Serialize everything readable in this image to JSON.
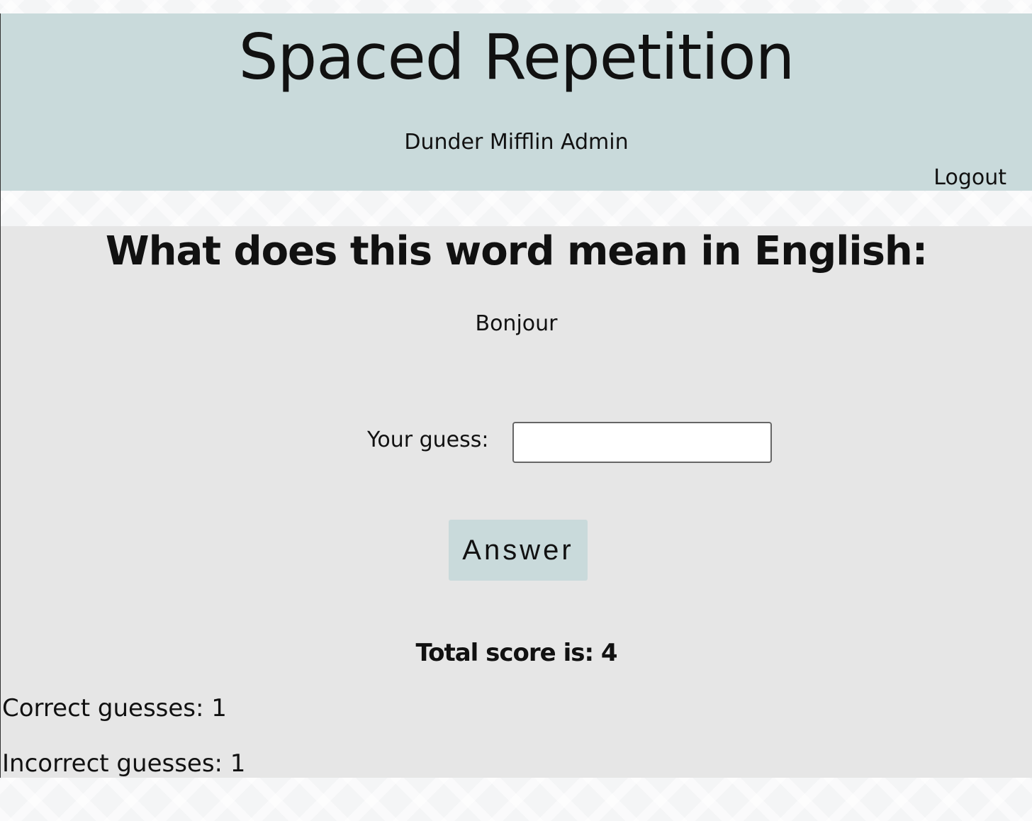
{
  "header": {
    "title": "Spaced Repetition",
    "user_name": "Dunder Mifflin Admin",
    "logout_label": "Logout"
  },
  "quiz": {
    "question": "What does this word mean in English:",
    "word": "Bonjour",
    "guess_label": "Your guess:",
    "guess_value": "",
    "answer_label": "Answer"
  },
  "score": {
    "total_text": "Total score is: 4",
    "correct_text": "Correct guesses: 1",
    "incorrect_text": "Incorrect guesses: 1"
  },
  "colors": {
    "header_bg": "#c9dadb",
    "main_bg": "#e6e6e6",
    "button_bg": "#c9dadb"
  }
}
